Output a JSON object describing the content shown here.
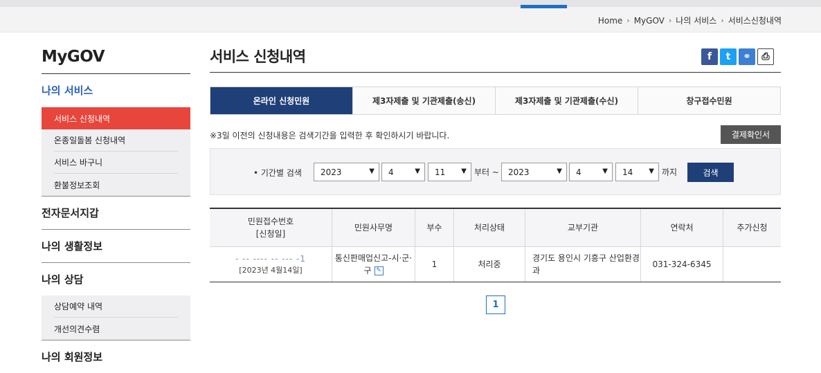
{
  "breadcrumb": [
    "Home",
    "MyGOV",
    "나의 서비스",
    "서비스신청내역"
  ],
  "sidebar": {
    "title": "MyGOV",
    "active_section": "나의 서비스",
    "items": [
      "서비스 신청내역",
      "온종일돌봄 신청내역",
      "서비스 바구니",
      "환불정보조회"
    ],
    "sections": [
      "전자문서지갑",
      "나의 생활정보",
      "나의 상담"
    ],
    "consult_items": [
      "상담예약 내역",
      "개선의견수렴"
    ],
    "last_section": "나의 회원정보"
  },
  "main": {
    "title": "서비스 신청내역",
    "share": {
      "fb": "f",
      "tw": "t",
      "ln": "⚭",
      "pr": "⎙"
    },
    "tabs": [
      "온라인 신청민원",
      "제3자제출 및 기관제출(송신)",
      "제3자제출 및 기관제출(수신)",
      "창구접수민원"
    ],
    "notice": "※3일 이전의 신청내용은 검색기간을 입력한 후 확인하시기 바랍니다.",
    "pay_button": "결제확인서"
  },
  "search": {
    "label": "• 기간별 검색",
    "from_year": "2023",
    "from_month": "4",
    "from_day": "11",
    "from_text": "부터 ~",
    "to_year": "2023",
    "to_month": "4",
    "to_day": "14",
    "to_text": "까지",
    "button": "검색"
  },
  "table": {
    "headers": [
      "민원접수번호",
      "[신청일]",
      "민원사무명",
      "부수",
      "처리상태",
      "교부기관",
      "연락처",
      "추가신청"
    ],
    "row": {
      "receipt_no": "- -- ---- -- --- -1",
      "date": "[2023년 4월14일]",
      "service": "통신판매업신고-시·군·구",
      "copies": "1",
      "status": "처리중",
      "agency": "경기도 용인시 기흥구 산업환경과",
      "contact": "031-324-6345",
      "extra": ""
    }
  },
  "pagination": {
    "current": "1"
  }
}
